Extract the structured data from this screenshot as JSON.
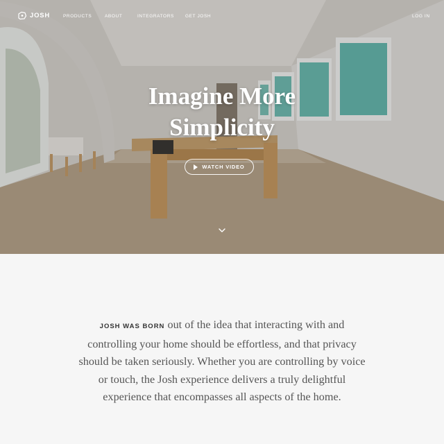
{
  "brand": {
    "name": "JOSH"
  },
  "nav": {
    "links": [
      "PRODUCTS",
      "ABOUT",
      "INTEGRATORS",
      "GET JOSH"
    ],
    "login": "LOG IN"
  },
  "hero": {
    "headline_line1": "Imagine More",
    "headline_line2": "Simplicity",
    "watch_video": "WATCH VIDEO",
    "scroll_icon": "chevron-down-icon"
  },
  "intro": {
    "lead": "JOSH WAS BORN",
    "body": " out of the idea that interacting with and controlling your home should be effortless, and that privacy should be taken seriously. Whether you are controlling by voice or touch, the Josh experience delivers a truly delightful experience that encompasses all aspects of the home."
  },
  "colors": {
    "page_bg": "#f6f6f6",
    "text": "#555555",
    "hero_text": "#ffffff"
  }
}
